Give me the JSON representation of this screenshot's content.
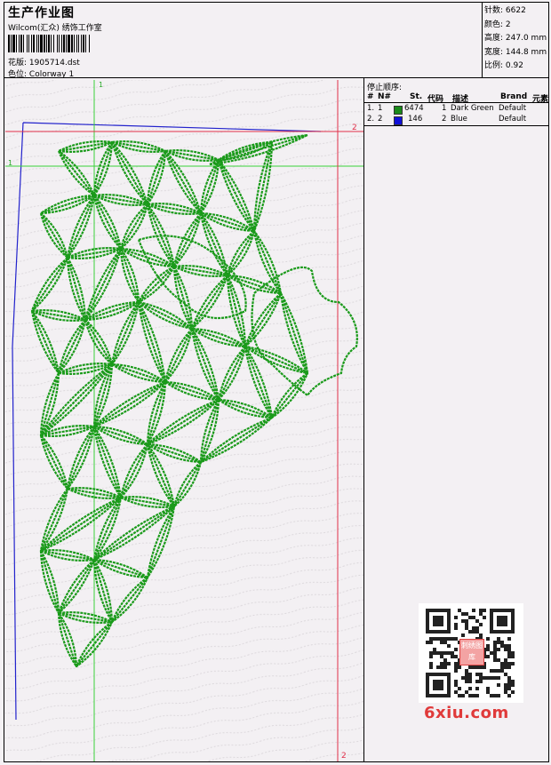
{
  "header": {
    "title": "生产作业图",
    "studio": "Wilcom(汇众) 绣饰工作室",
    "design_label": "花版:",
    "design_value": "1905714.dst",
    "colorway_label": "色位:",
    "colorway_value": "Colorway 1"
  },
  "stats": [
    {
      "label": "针数:",
      "value": "6622"
    },
    {
      "label": "颜色:",
      "value": "2"
    },
    {
      "label": "高度:",
      "value": "247.0 mm"
    },
    {
      "label": "宽度:",
      "value": "144.8 mm"
    },
    {
      "label": "比例:",
      "value": "0.92"
    }
  ],
  "stop_sequence": {
    "title": "停止顺序:",
    "columns": [
      "#",
      "N#",
      "St.",
      "代码",
      "描述",
      "Brand",
      "元素"
    ],
    "rows": [
      {
        "idx": "1.",
        "n": "1",
        "color": "#1a8a1a",
        "stitches": "6474",
        "code": "1",
        "desc": "Dark Green",
        "brand": "Default"
      },
      {
        "idx": "2.",
        "n": "2",
        "color": "#1010d8",
        "stitches": "146",
        "code": "2",
        "desc": "Blue",
        "brand": "Default"
      }
    ]
  },
  "guides": {
    "green_v": "1",
    "green_h": "1",
    "red_top": "2",
    "red_bottom": "2"
  },
  "watermark": {
    "qr_badge": "刺绣图库",
    "brand": "6xiu.com"
  },
  "colors": {
    "design_green": "#1a9a1a",
    "guide_green": "#3ad23a",
    "guide_red": "#e0304a",
    "outline_blue": "#2222cc"
  }
}
